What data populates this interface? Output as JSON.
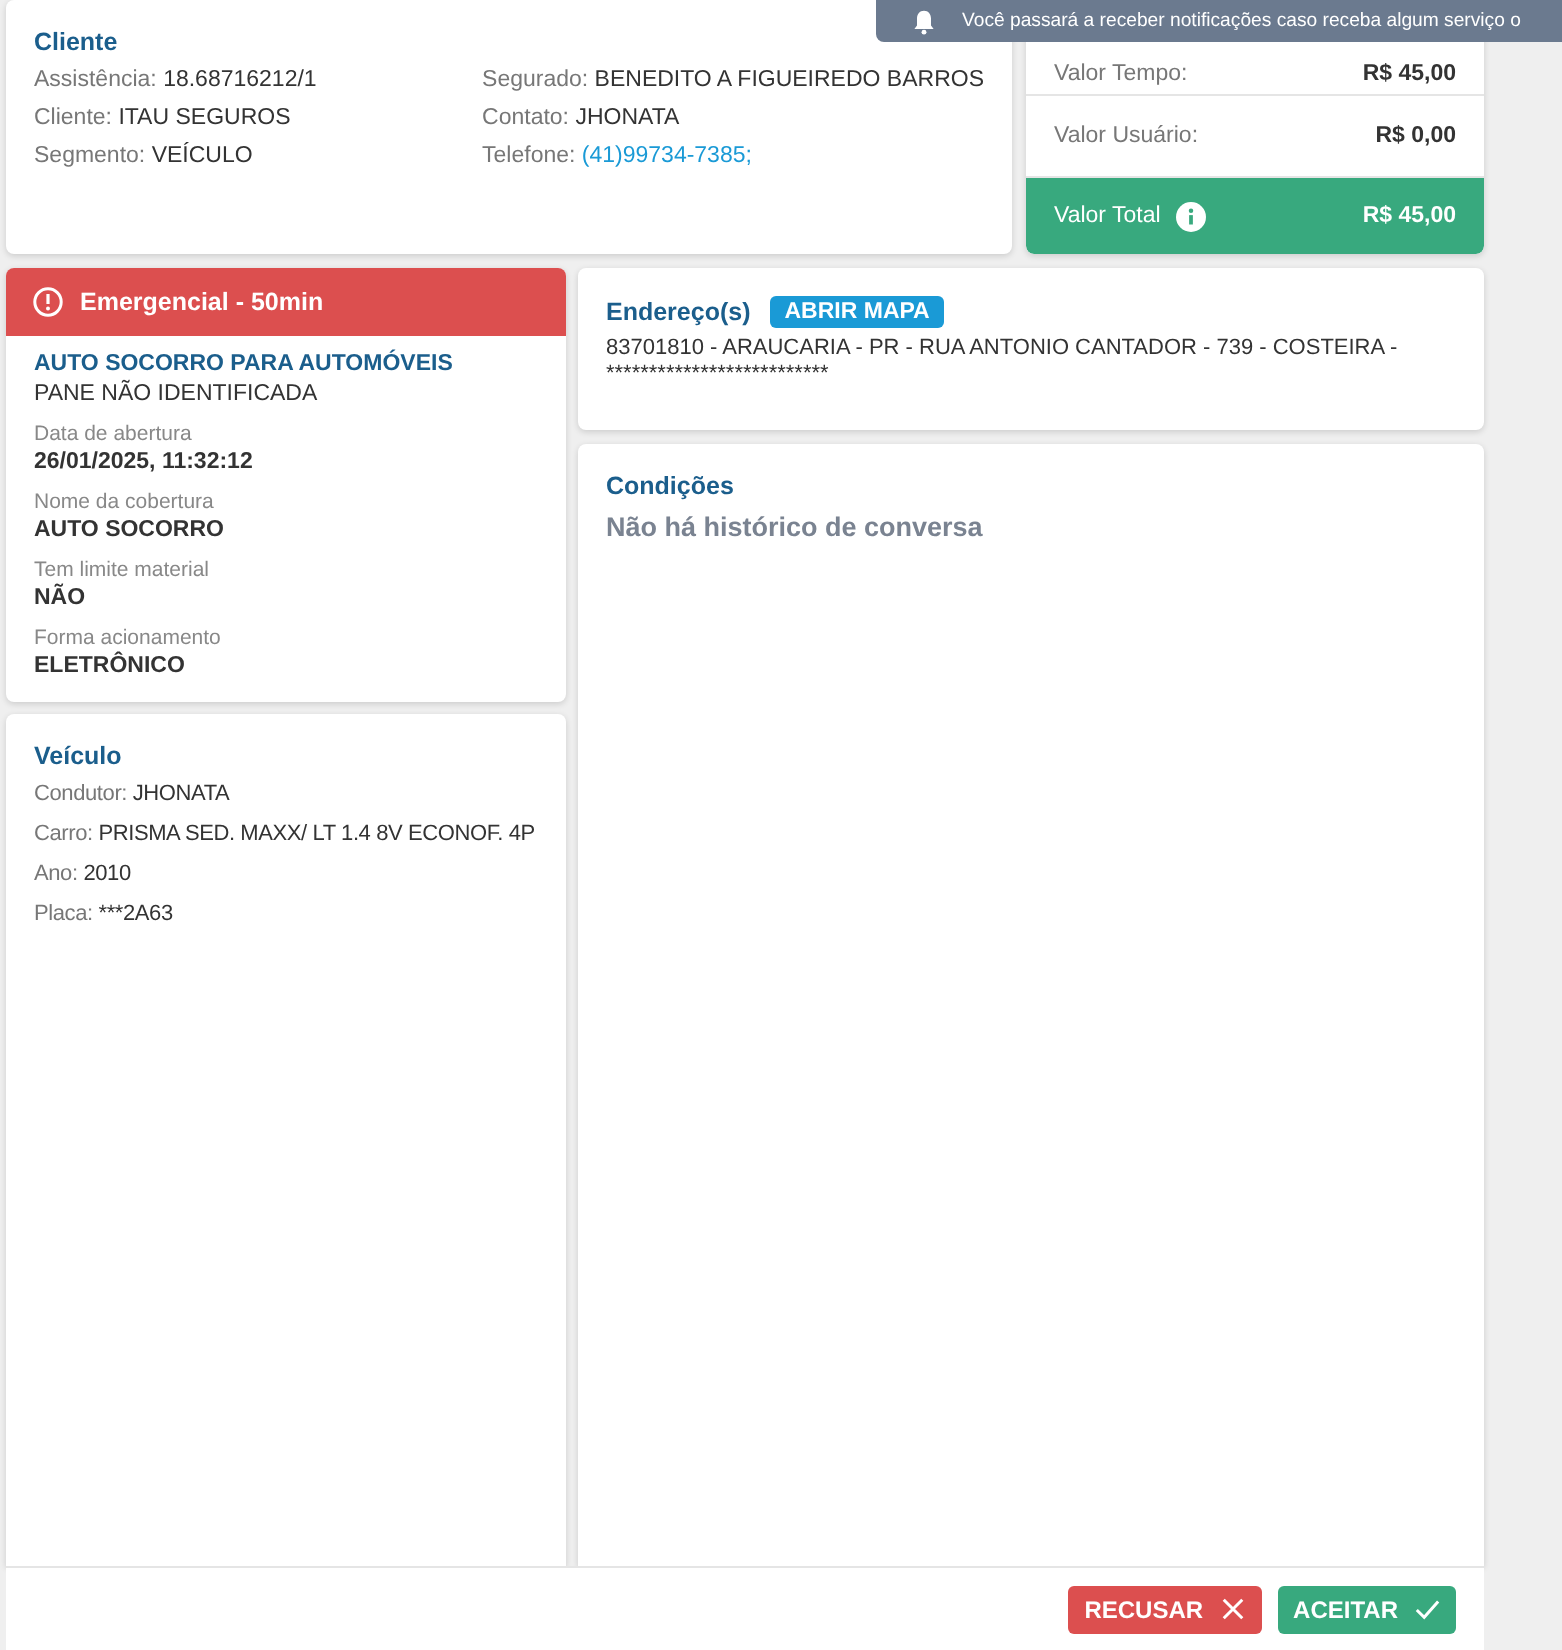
{
  "notification": {
    "text": "Você passará a receber notificações caso receba algum serviço o"
  },
  "client_card": {
    "title": "Cliente",
    "columns": [
      [
        {
          "label": "Assistência:",
          "value": "18.68716212/1",
          "kind": "text"
        },
        {
          "label": "Cliente:",
          "value": "ITAU SEGUROS",
          "kind": "text"
        },
        {
          "label": "Segmento:",
          "value": "VEÍCULO",
          "kind": "text"
        }
      ],
      [
        {
          "label": "Segurado:",
          "value": "BENEDITO A FIGUEIREDO BARROS",
          "kind": "text"
        },
        {
          "label": "Contato:",
          "value": "JHONATA",
          "kind": "text"
        },
        {
          "label": "Telefone:",
          "value": "(41)99734-7385;",
          "kind": "link"
        }
      ]
    ]
  },
  "values_card": {
    "rows": [
      {
        "label": "Valor Tempo:",
        "value": "R$ 45,00",
        "kind": "plain"
      },
      {
        "label": "Valor Usuário:",
        "value": "R$ 0,00",
        "kind": "plain"
      },
      {
        "label": "Valor Total",
        "value": "R$ 45,00",
        "kind": "total"
      }
    ]
  },
  "service_card": {
    "badge": "Emergencial - 50min",
    "service": "AUTO SOCORRO PARA AUTOMÓVEIS",
    "problem": "PANE NÃO IDENTIFICADA",
    "details": [
      {
        "label": "Data de abertura",
        "value": "26/01/2025, 11:32:12"
      },
      {
        "label": "Nome da cobertura",
        "value": "AUTO SOCORRO"
      },
      {
        "label": "Tem limite material",
        "value": "NÃO"
      },
      {
        "label": "Forma acionamento",
        "value": "ELETRÔNICO"
      }
    ]
  },
  "vehicle_card": {
    "title": "Veículo",
    "fields": [
      {
        "label": "Condutor:",
        "value": "JHONATA"
      },
      {
        "label": "Carro:",
        "value": "PRISMA SED. MAXX/ LT 1.4 8V ECONOF. 4P"
      },
      {
        "label": "Ano:",
        "value": "2010"
      },
      {
        "label": "Placa:",
        "value": "***2A63"
      }
    ]
  },
  "address_card": {
    "title": "Endereço(s)",
    "map_button": "ABRIR MAPA",
    "address": "83701810 - ARAUCARIA - PR - RUA ANTONIO CANTADOR - 739 - COSTEIRA - **************************"
  },
  "conditions_card": {
    "title": "Condições",
    "empty_message": "Não há histórico de conversa"
  },
  "actions": [
    {
      "label": "RECUSAR",
      "kind": "reject"
    },
    {
      "label": "ACEITAR",
      "kind": "accept"
    }
  ]
}
